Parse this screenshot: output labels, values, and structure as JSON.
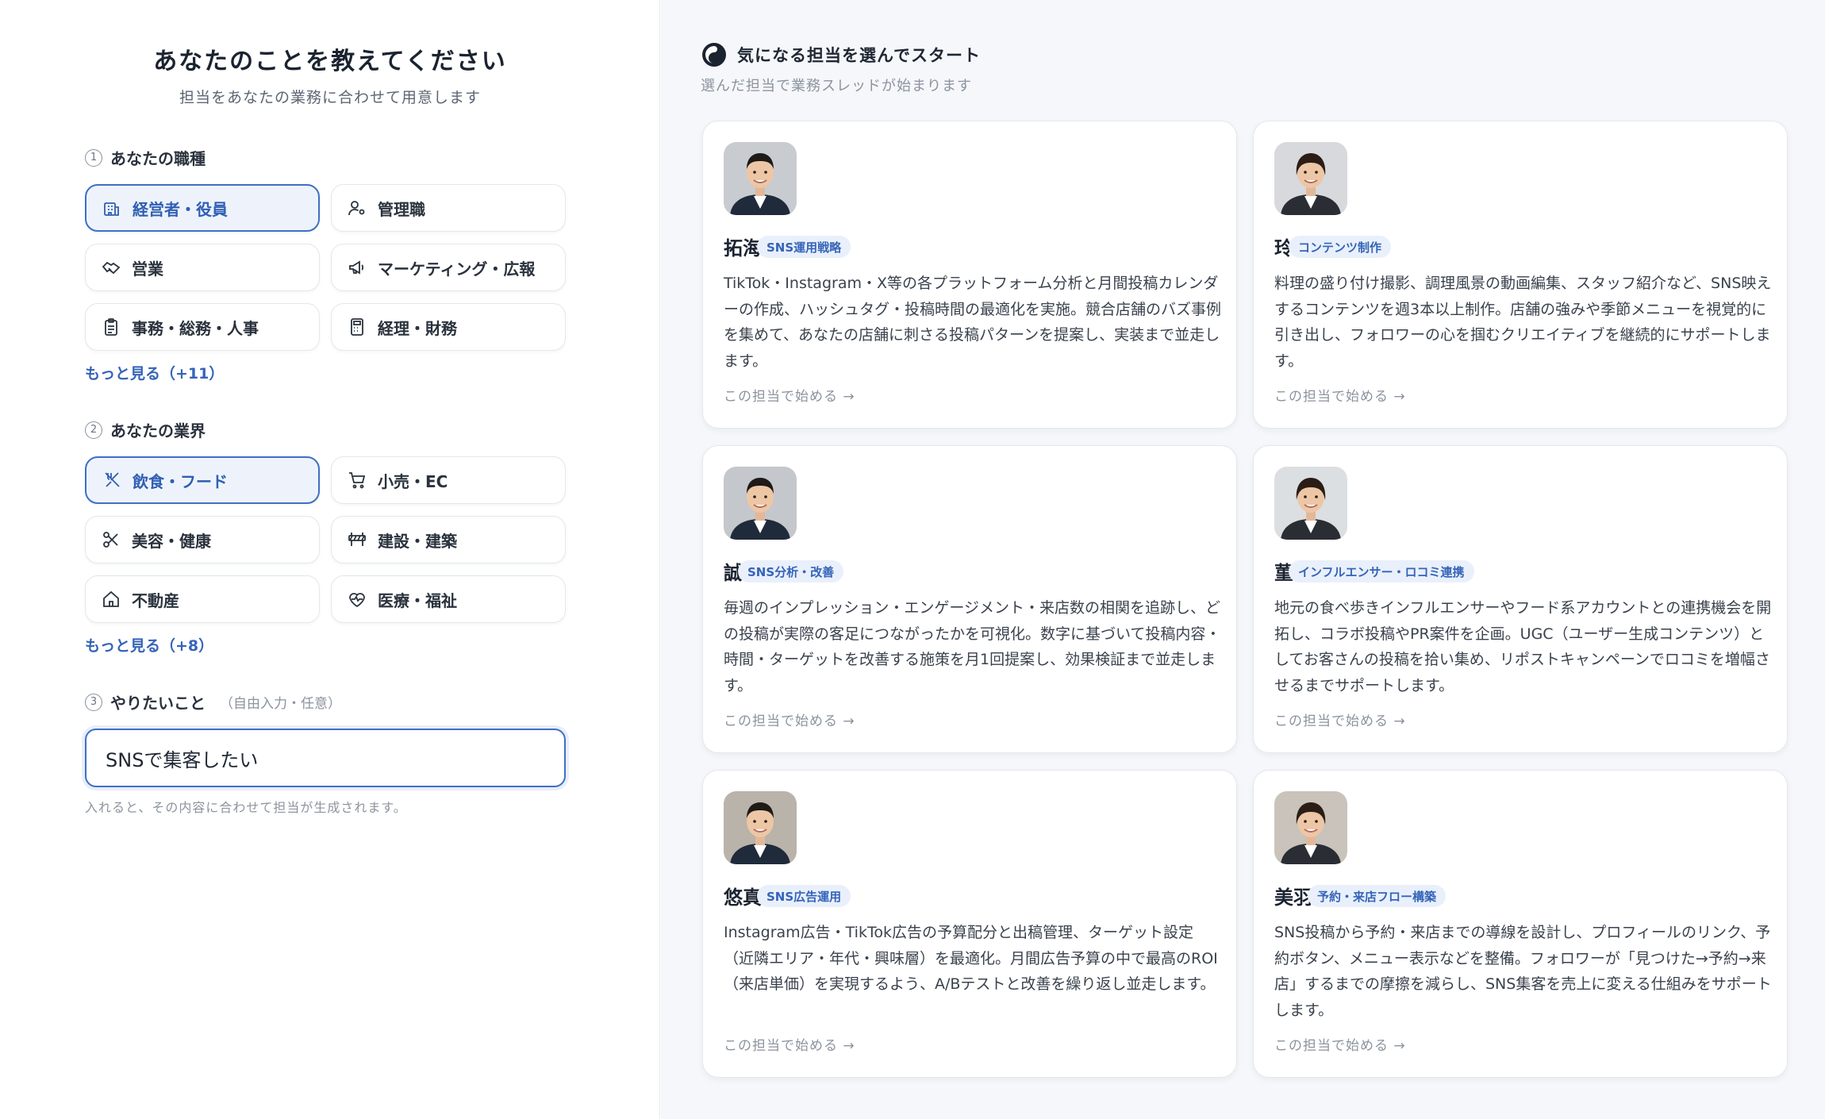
{
  "left": {
    "title": "あなたのことを教えてください",
    "subtitle": "担当をあなたの業務に合わせて用意します",
    "section1": {
      "num": "1",
      "label": "あなたの職種",
      "options": [
        {
          "label": "経営者・役員",
          "icon": "building-icon",
          "selected": true
        },
        {
          "label": "管理職",
          "icon": "person-gear-icon",
          "selected": false
        },
        {
          "label": "営業",
          "icon": "handshake-icon",
          "selected": false
        },
        {
          "label": "マーケティング・広報",
          "icon": "megaphone-icon",
          "selected": false
        },
        {
          "label": "事務・総務・人事",
          "icon": "clipboard-icon",
          "selected": false
        },
        {
          "label": "経理・財務",
          "icon": "calculator-icon",
          "selected": false
        }
      ],
      "more": "もっと見る（+11）"
    },
    "section2": {
      "num": "2",
      "label": "あなたの業界",
      "options": [
        {
          "label": "飲食・フード",
          "icon": "utensils-icon",
          "selected": true
        },
        {
          "label": "小売・EC",
          "icon": "cart-icon",
          "selected": false
        },
        {
          "label": "美容・健康",
          "icon": "scissors-icon",
          "selected": false
        },
        {
          "label": "建設・建築",
          "icon": "barrier-icon",
          "selected": false
        },
        {
          "label": "不動産",
          "icon": "house-icon",
          "selected": false
        },
        {
          "label": "医療・福祉",
          "icon": "heart-pulse-icon",
          "selected": false
        }
      ],
      "more": "もっと見る（+8）"
    },
    "section3": {
      "num": "3",
      "label": "やりたいこと",
      "sub": "（自由入力・任意）",
      "value": "SNSで集客したい",
      "hint": "入れると、その内容に合わせて担当が生成されます。"
    }
  },
  "right": {
    "title": "気になる担当を選んでスタート",
    "subtitle": "選んだ担当で業務スレッドが始まります",
    "cards": [
      {
        "name": "拓海",
        "tag": "SNS運用戦略",
        "desc": "TikTok・Instagram・X等の各プラットフォーム分析と月間投稿カレンダーの作成、ハッシュタグ・投稿時間の最適化を実施。競合店舗のバズ事例を集めて、あなたの店舗に刺さる投稿パターンを提案し、実装まで並走します。",
        "cta": "この担当で始める →",
        "gender": "m"
      },
      {
        "name": "玲",
        "tag": "コンテンツ制作",
        "desc": "料理の盛り付け撮影、調理風景の動画編集、スタッフ紹介など、SNS映えするコンテンツを週3本以上制作。店舗の強みや季節メニューを視覚的に引き出し、フォロワーの心を掴むクリエイティブを継続的にサポートします。",
        "cta": "この担当で始める →",
        "gender": "f"
      },
      {
        "name": "誠",
        "tag": "SNS分析・改善",
        "desc": "毎週のインプレッション・エンゲージメント・来店数の相関を追跡し、どの投稿が実際の客足につながったかを可視化。数字に基づいて投稿内容・時間・ターゲットを改善する施策を月1回提案し、効果検証まで並走します。",
        "cta": "この担当で始める →",
        "gender": "m"
      },
      {
        "name": "菫",
        "tag": "インフルエンサー・ロコミ連携",
        "desc": "地元の食べ歩きインフルエンサーやフード系アカウントとの連携機会を開拓し、コラボ投稿やPR案件を企画。UGC（ユーザー生成コンテンツ）としてお客さんの投稿を拾い集め、リポストキャンペーンでロコミを増幅させるまでサポートします。",
        "cta": "この担当で始める →",
        "gender": "f"
      },
      {
        "name": "悠真",
        "tag": "SNS広告運用",
        "desc": "Instagram広告・TikTok広告の予算配分と出稿管理、ターゲット設定（近隣エリア・年代・興味層）を最適化。月間広告予算の中で最高のROI（来店単価）を実現するよう、A/Bテストと改善を繰り返し並走します。",
        "cta": "この担当で始める →",
        "gender": "m"
      },
      {
        "name": "美羽",
        "tag": "予約・来店フロー構築",
        "desc": "SNS投稿から予約・来店までの導線を設計し、プロフィールのリンク、予約ボタン、メニュー表示などを整備。フォロワーが「見つけた→予約→来店」するまでの摩擦を減らし、SNS集客を売上に変える仕組みをサポートします。",
        "cta": "この担当で始める →",
        "gender": "f"
      }
    ]
  },
  "colors": {
    "accent": "#3e6fc4",
    "accent_bg": "#eef3fb",
    "tag_bg": "#e9f0fb"
  }
}
